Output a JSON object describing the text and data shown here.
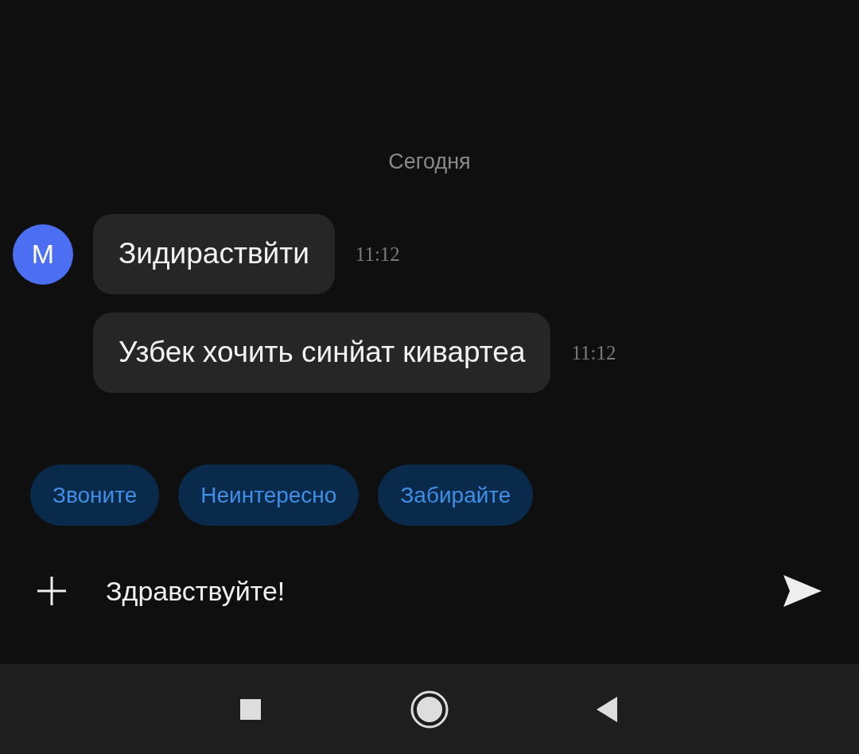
{
  "date_divider": "Сегодня",
  "sender": {
    "initial": "М"
  },
  "messages": [
    {
      "text": "Зидираствйти",
      "time": "11:12"
    },
    {
      "text": "Узбек хочить синйат кивартеа",
      "time": "11:12"
    }
  ],
  "quick_replies": [
    "Звоните",
    "Неинтересно",
    "Забирайте"
  ],
  "composer": {
    "value": "Здравствуйте!"
  }
}
